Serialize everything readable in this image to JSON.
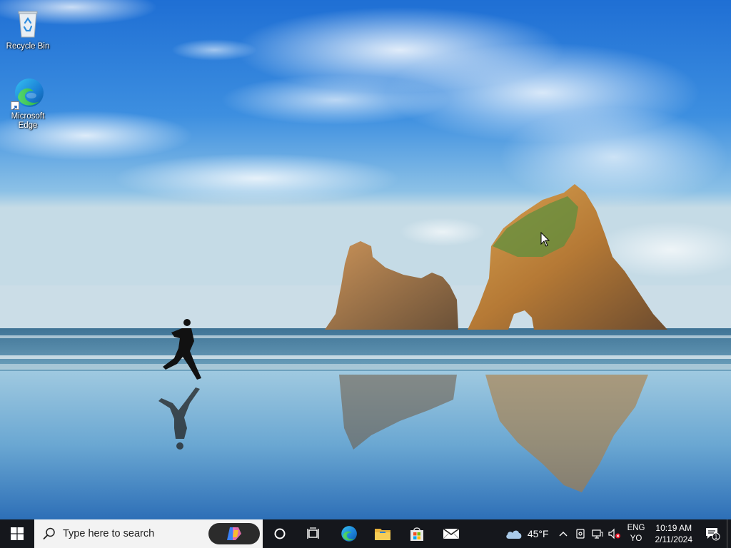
{
  "desktop": {
    "icons": [
      {
        "label": "Recycle Bin",
        "icon": "recycle-bin-icon"
      },
      {
        "label": "Microsoft Edge",
        "icon": "edge-icon"
      }
    ]
  },
  "taskbar": {
    "start_icon": "windows-logo-icon",
    "search": {
      "placeholder": "Type here to search",
      "icon": "search-icon",
      "copilot_icon": "copilot-icon"
    },
    "buttons": [
      {
        "name": "cortana",
        "icon": "cortana-circle-icon"
      },
      {
        "name": "task-view",
        "icon": "task-view-icon"
      },
      {
        "name": "edge",
        "icon": "edge-icon"
      },
      {
        "name": "file-explorer",
        "icon": "folder-icon"
      },
      {
        "name": "microsoft-store",
        "icon": "store-bag-icon"
      },
      {
        "name": "mail",
        "icon": "mail-envelope-icon"
      }
    ],
    "tray": {
      "weather_temp": "45°F",
      "weather_icon": "cloud-icon",
      "language_line1": "ENG",
      "language_line2": "YO",
      "time": "10:19 AM",
      "date": "2/11/2024",
      "notification_count": "1"
    }
  },
  "colors": {
    "taskbar_bg": "#15171c",
    "search_bg": "#f3f3f3",
    "windows_blue": "#00a4ef"
  }
}
